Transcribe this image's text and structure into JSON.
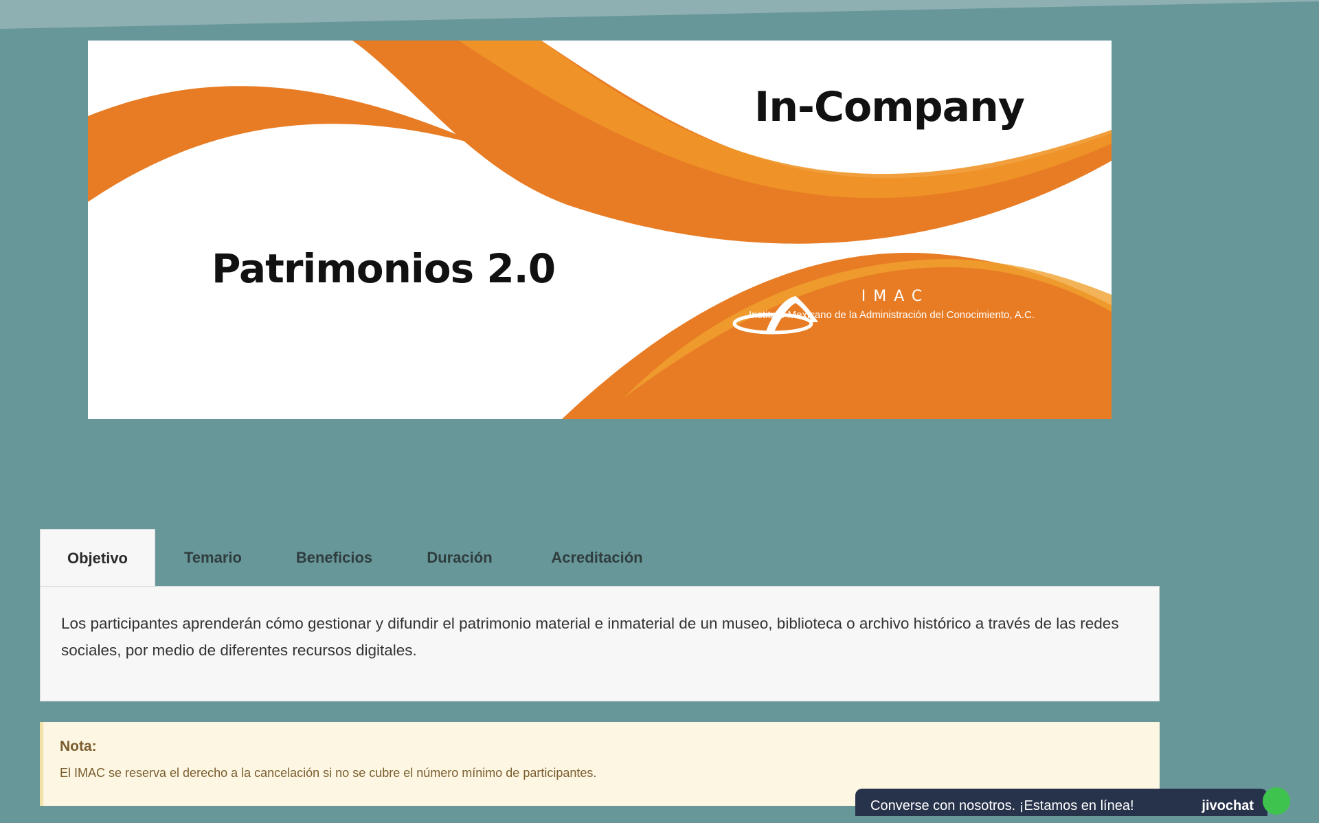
{
  "banner": {
    "title_right": "In-Company",
    "title_left": "Patrimonios 2.0",
    "logo_word": "IMAC",
    "logo_sub": "Instituto Mexicano de la Administración del Conocimiento, A.C.",
    "logo_icon": "imac-arch-logo"
  },
  "tabs": [
    {
      "label": "Objetivo",
      "active": true
    },
    {
      "label": "Temario",
      "active": false
    },
    {
      "label": "Beneficios",
      "active": false
    },
    {
      "label": "Duración",
      "active": false
    },
    {
      "label": "Acreditación",
      "active": false
    }
  ],
  "panel": {
    "text": "Los participantes aprenderán cómo gestionar y difundir el patrimonio material e inmaterial de un museo, biblioteca o archivo histórico a través de las redes sociales, por medio de diferentes recursos digitales."
  },
  "note": {
    "title": "Nota:",
    "text": "El IMAC se reserva el derecho a la cancelación si no se cubre el número mínimo de participantes."
  },
  "chat": {
    "text": "Converse con nosotros. ¡Estamos en línea!",
    "brand": "jivochat"
  },
  "colors": {
    "page_bg": "#68979a",
    "orange": "#e87c24",
    "orange_light": "#f0a12f",
    "note_bg": "#fcf6e2",
    "chat_bg": "#27324b"
  }
}
